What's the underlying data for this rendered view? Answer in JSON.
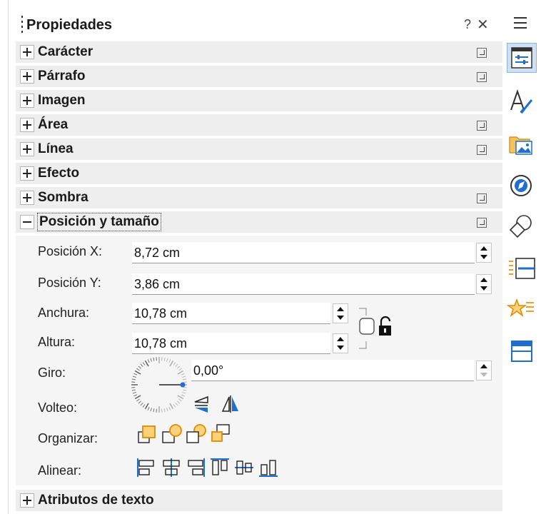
{
  "panel": {
    "title": "Propiedades",
    "help": "?",
    "close": "✕"
  },
  "sections": {
    "caracter": "Carácter",
    "parrafo": "Párrafo",
    "imagen": "Imagen",
    "area": "Área",
    "linea": "Línea",
    "efecto": "Efecto",
    "sombra": "Sombra",
    "posicion": "Posición y tamaño",
    "atributos": "Atributos de texto"
  },
  "position_size": {
    "pos_x_label": "Posición X:",
    "pos_x_value": "8,72 cm",
    "pos_y_label": "Posición Y:",
    "pos_y_value": "3,86 cm",
    "width_label": "Anchura:",
    "width_value": "10,78 cm",
    "height_label": "Altura:",
    "height_value": "10,78 cm",
    "rotation_label": "Giro:",
    "rotation_value": "0,00°",
    "flip_label": "Volteo:",
    "arrange_label": "Organizar:",
    "align_label": "Alinear:"
  },
  "colors": {
    "accent": "#1f6fcf",
    "orange": "#f0a020",
    "section_bg": "#eeeeee",
    "pane_bg": "#f5f5f5"
  },
  "sidebar_tabs": [
    "properties-icon",
    "styles-icon",
    "gallery-icon",
    "navigator-icon",
    "shapes-icon",
    "page-icon",
    "animation-icon",
    "slide-transition-icon"
  ]
}
